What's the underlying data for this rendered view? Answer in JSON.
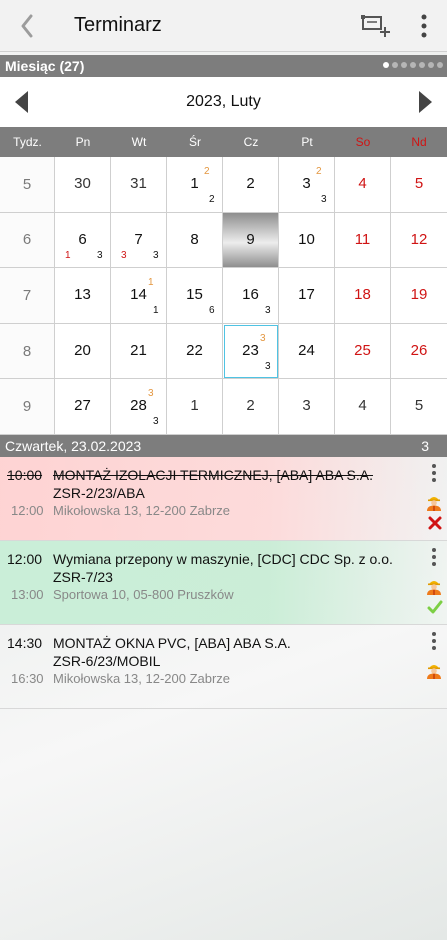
{
  "topbar": {
    "title": "Terminarz",
    "back_icon": "chevron-left-icon",
    "add_icon": "add-task-icon",
    "menu_icon": "kebab-menu-icon"
  },
  "view_bar": {
    "label": "Miesiąc (27)",
    "pages": 7,
    "active_page": 1
  },
  "month_nav": {
    "label": "2023, Luty"
  },
  "calendar": {
    "week_header": "Tydz.",
    "days": [
      "Pn",
      "Wt",
      "Śr",
      "Cz",
      "Pt",
      "So",
      "Nd"
    ],
    "weekend_color": "#d01414",
    "today_cell": "9",
    "selected_cell": "23",
    "weeks": [
      {
        "week": "5",
        "cells": [
          {
            "day": "30",
            "sup": "",
            "count": "",
            "red": "",
            "other": true
          },
          {
            "day": "31",
            "sup": "",
            "count": "",
            "red": "",
            "other": true
          },
          {
            "day": "1",
            "sup": "2",
            "count": "2",
            "red": ""
          },
          {
            "day": "2",
            "sup": "",
            "count": "",
            "red": ""
          },
          {
            "day": "3",
            "sup": "2",
            "count": "3",
            "red": ""
          },
          {
            "day": "4",
            "sup": "",
            "count": "",
            "red": "",
            "weekend": true
          },
          {
            "day": "5",
            "sup": "",
            "count": "",
            "red": "",
            "weekend": true
          }
        ]
      },
      {
        "week": "6",
        "cells": [
          {
            "day": "6",
            "sup": "",
            "count": "3",
            "red": "1"
          },
          {
            "day": "7",
            "sup": "",
            "count": "3",
            "red": "3"
          },
          {
            "day": "8",
            "sup": "",
            "count": "",
            "red": ""
          },
          {
            "day": "9",
            "sup": "",
            "count": "",
            "red": "",
            "today": true
          },
          {
            "day": "10",
            "sup": "",
            "count": "",
            "red": ""
          },
          {
            "day": "11",
            "sup": "",
            "count": "",
            "red": "",
            "weekend": true
          },
          {
            "day": "12",
            "sup": "",
            "count": "",
            "red": "",
            "weekend": true
          }
        ]
      },
      {
        "week": "7",
        "cells": [
          {
            "day": "13",
            "sup": "",
            "count": "",
            "red": ""
          },
          {
            "day": "14",
            "sup": "1",
            "count": "1",
            "red": ""
          },
          {
            "day": "15",
            "sup": "",
            "count": "6",
            "red": ""
          },
          {
            "day": "16",
            "sup": "",
            "count": "3",
            "red": ""
          },
          {
            "day": "17",
            "sup": "",
            "count": "",
            "red": ""
          },
          {
            "day": "18",
            "sup": "",
            "count": "",
            "red": "",
            "weekend": true
          },
          {
            "day": "19",
            "sup": "",
            "count": "",
            "red": "",
            "weekend": true
          }
        ]
      },
      {
        "week": "8",
        "cells": [
          {
            "day": "20",
            "sup": "",
            "count": "",
            "red": ""
          },
          {
            "day": "21",
            "sup": "",
            "count": "",
            "red": ""
          },
          {
            "day": "22",
            "sup": "",
            "count": "",
            "red": ""
          },
          {
            "day": "23",
            "sup": "3",
            "count": "3",
            "red": "",
            "selected": true
          },
          {
            "day": "24",
            "sup": "",
            "count": "",
            "red": ""
          },
          {
            "day": "25",
            "sup": "",
            "count": "",
            "red": "",
            "weekend": true
          },
          {
            "day": "26",
            "sup": "",
            "count": "",
            "red": "",
            "weekend": true
          }
        ]
      },
      {
        "week": "9",
        "cells": [
          {
            "day": "27",
            "sup": "",
            "count": "",
            "red": ""
          },
          {
            "day": "28",
            "sup": "3",
            "count": "3",
            "red": ""
          },
          {
            "day": "1",
            "sup": "",
            "count": "",
            "red": "",
            "other": true
          },
          {
            "day": "2",
            "sup": "",
            "count": "",
            "red": "",
            "other": true
          },
          {
            "day": "3",
            "sup": "",
            "count": "",
            "red": "",
            "other": true
          },
          {
            "day": "4",
            "sup": "",
            "count": "",
            "red": "",
            "other": true
          },
          {
            "day": "5",
            "sup": "",
            "count": "",
            "red": "",
            "other": true
          }
        ]
      }
    ]
  },
  "day_bar": {
    "label": "Czwartek, 23.02.2023",
    "count": "3"
  },
  "appointments": [
    {
      "start": "10:00",
      "end": "12:00",
      "title": "MONTAŻ IZOLACJI TERMICZNEJ, [ABA] ABA S.A.",
      "code": "ZSR-2/23/ABA",
      "address": "Mikołowska 13, 12-200 Zabrze",
      "state": "cancelled",
      "status_icon": "close-icon"
    },
    {
      "start": "12:00",
      "end": "13:00",
      "title": "Wymiana przepony w maszynie, [CDC] CDC Sp. z o.o.",
      "code": "ZSR-7/23",
      "address": "Sportowa 10, 05-800 Pruszków",
      "state": "done",
      "status_icon": "check-icon"
    },
    {
      "start": "14:30",
      "end": "16:30",
      "title": "MONTAŻ OKNA PVC, [ABA] ABA S.A.",
      "code": "ZSR-6/23/MOBIL",
      "address": "Mikołowska 13, 12-200 Zabrze",
      "state": "open",
      "status_icon": ""
    }
  ]
}
